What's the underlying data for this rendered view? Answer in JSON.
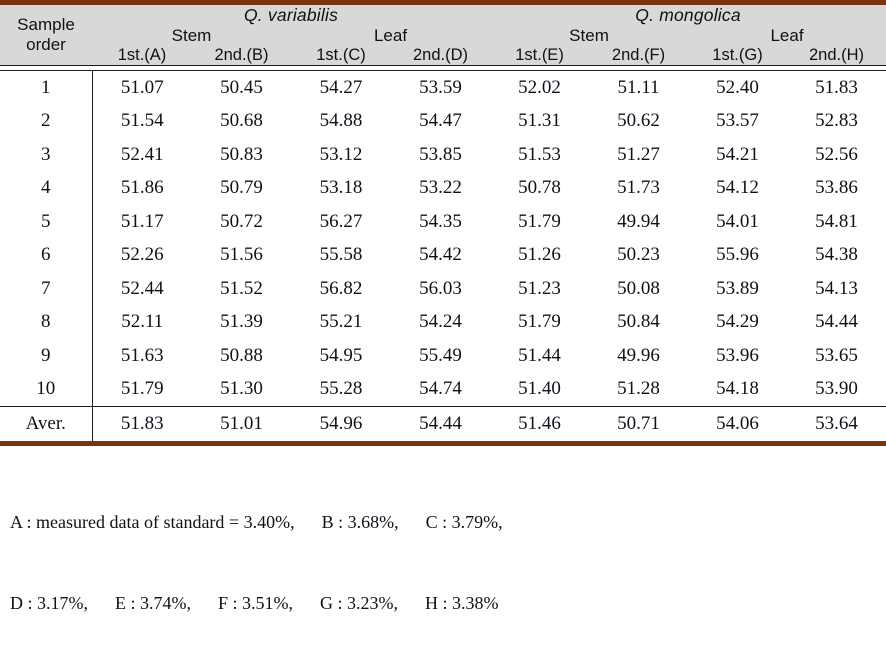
{
  "colors": {
    "rule": "#7a3410",
    "header_bg": "#d8d8d8",
    "grid": "#1a1a1a",
    "text": "#10101a"
  },
  "table": {
    "corner_header": "Sample\norder",
    "corner_header_line1": "Sample",
    "corner_header_line2": "order",
    "species": [
      {
        "name": "Q.  variabilis",
        "organs": [
          "Stem",
          "Leaf"
        ]
      },
      {
        "name": "Q.  mongolica",
        "organs": [
          "Stem",
          "Leaf"
        ]
      }
    ],
    "measure_columns": [
      "1st.(A)",
      "2nd.(B)",
      "1st.(C)",
      "2nd.(D)",
      "1st.(E)",
      "2nd.(F)",
      "1st.(G)",
      "2nd.(H)"
    ],
    "rows": [
      {
        "order": "1",
        "values": [
          "51.07",
          "50.45",
          "54.27",
          "53.59",
          "52.02",
          "51.11",
          "52.40",
          "51.83"
        ]
      },
      {
        "order": "2",
        "values": [
          "51.54",
          "50.68",
          "54.88",
          "54.47",
          "51.31",
          "50.62",
          "53.57",
          "52.83"
        ]
      },
      {
        "order": "3",
        "values": [
          "52.41",
          "50.83",
          "53.12",
          "53.85",
          "51.53",
          "51.27",
          "54.21",
          "52.56"
        ]
      },
      {
        "order": "4",
        "values": [
          "51.86",
          "50.79",
          "53.18",
          "53.22",
          "50.78",
          "51.73",
          "54.12",
          "53.86"
        ]
      },
      {
        "order": "5",
        "values": [
          "51.17",
          "50.72",
          "56.27",
          "54.35",
          "51.79",
          "49.94",
          "54.01",
          "54.81"
        ]
      },
      {
        "order": "6",
        "values": [
          "52.26",
          "51.56",
          "55.58",
          "54.42",
          "51.26",
          "50.23",
          "55.96",
          "54.38"
        ]
      },
      {
        "order": "7",
        "values": [
          "52.44",
          "51.52",
          "56.82",
          "56.03",
          "51.23",
          "50.08",
          "53.89",
          "54.13"
        ]
      },
      {
        "order": "8",
        "values": [
          "52.11",
          "51.39",
          "55.21",
          "54.24",
          "51.79",
          "50.84",
          "54.29",
          "54.44"
        ]
      },
      {
        "order": "9",
        "values": [
          "51.63",
          "50.88",
          "54.95",
          "55.49",
          "51.44",
          "49.96",
          "53.96",
          "53.65"
        ]
      },
      {
        "order": "10",
        "values": [
          "51.79",
          "51.30",
          "55.28",
          "54.74",
          "51.40",
          "51.28",
          "54.18",
          "53.90"
        ]
      }
    ],
    "average_row": {
      "order": "Aver.",
      "values": [
        "51.83",
        "51.01",
        "54.96",
        "54.44",
        "51.46",
        "50.71",
        "54.06",
        "53.64"
      ]
    }
  },
  "footnote": {
    "line1": "A : measured data of standard = 3.40%,      B : 3.68%,      C : 3.79%,",
    "line2": "D : 3.17%,      E : 3.74%,      F : 3.51%,      G : 3.23%,      H : 3.38%",
    "entries": [
      {
        "label": "A",
        "value": "3.40%",
        "note": "measured data of standard"
      },
      {
        "label": "B",
        "value": "3.68%"
      },
      {
        "label": "C",
        "value": "3.79%"
      },
      {
        "label": "D",
        "value": "3.17%"
      },
      {
        "label": "E",
        "value": "3.74%"
      },
      {
        "label": "F",
        "value": "3.51%"
      },
      {
        "label": "G",
        "value": "3.23%"
      },
      {
        "label": "H",
        "value": "3.38%"
      }
    ]
  }
}
